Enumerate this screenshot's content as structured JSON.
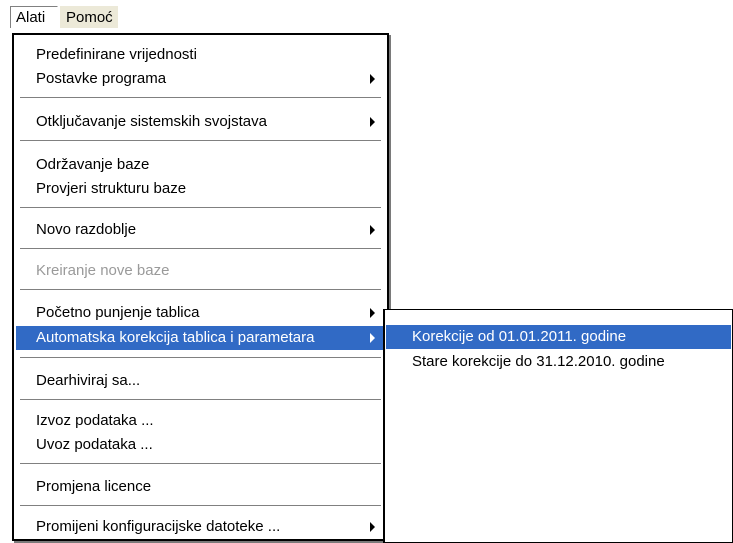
{
  "menubar": {
    "items": [
      {
        "label": "Alati"
      },
      {
        "label": "Pomoć"
      }
    ]
  },
  "main_menu": {
    "items": [
      {
        "label": "Predefinirane vrijednosti",
        "has_submenu": false,
        "enabled": true
      },
      {
        "label": "Postavke programa",
        "has_submenu": true,
        "enabled": true
      },
      {
        "label": "Otključavanje sistemskih svojstava",
        "has_submenu": true,
        "enabled": true
      },
      {
        "label": "Održavanje baze",
        "has_submenu": false,
        "enabled": true
      },
      {
        "label": "Provjeri strukturu baze",
        "has_submenu": false,
        "enabled": true
      },
      {
        "label": "Novo razdoblje",
        "has_submenu": true,
        "enabled": true
      },
      {
        "label": "Kreiranje nove baze",
        "has_submenu": false,
        "enabled": false
      },
      {
        "label": "Početno punjenje tablica",
        "has_submenu": true,
        "enabled": true
      },
      {
        "label": "Automatska korekcija tablica i parametara",
        "has_submenu": true,
        "enabled": true,
        "highlighted": true
      },
      {
        "label": "Dearhiviraj sa...",
        "has_submenu": false,
        "enabled": true
      },
      {
        "label": "Izvoz podataka ...",
        "has_submenu": false,
        "enabled": true
      },
      {
        "label": "Uvoz podataka ...",
        "has_submenu": false,
        "enabled": true
      },
      {
        "label": "Promjena licence",
        "has_submenu": false,
        "enabled": true
      },
      {
        "label": "Promijeni konfiguracijske datoteke ...",
        "has_submenu": true,
        "enabled": true
      }
    ]
  },
  "submenu": {
    "items": [
      {
        "label": "Korekcije od 01.01.2011. godine",
        "highlighted": true
      },
      {
        "label": "Stare korekcije do 31.12.2010. godine",
        "highlighted": false
      }
    ]
  },
  "colors": {
    "highlight": "#316ac5",
    "disabled_text": "#9a9a9a",
    "menubar_bg": "#ece9d8"
  }
}
